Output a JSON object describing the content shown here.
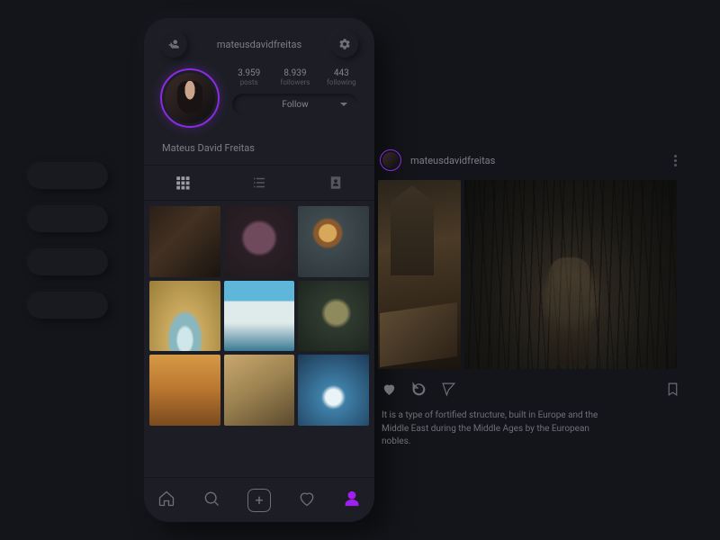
{
  "profile": {
    "username": "mateusdavidfreitas",
    "display_name": "Mateus David Freitas",
    "stats": {
      "posts": {
        "n": "3.959",
        "l": "posts"
      },
      "followers": {
        "n": "8.939",
        "l": "followers"
      },
      "following": {
        "n": "443",
        "l": "following"
      }
    },
    "follow_label": "Follow"
  },
  "detail": {
    "username": "mateusdavidfreitas",
    "caption": "It is a type of fortified structure, built in Europe and the Middle East during the Middle Ages by the European nobles."
  }
}
